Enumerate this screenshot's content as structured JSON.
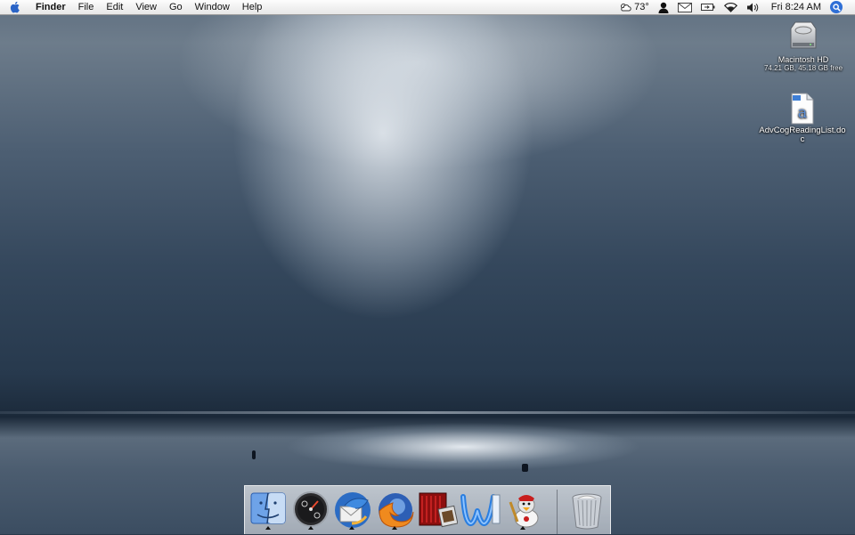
{
  "menubar": {
    "app_name": "Finder",
    "menus": [
      "File",
      "Edit",
      "View",
      "Go",
      "Window",
      "Help"
    ],
    "weather": "73°",
    "clock": "Fri 8:24 AM"
  },
  "desktop": {
    "icons": [
      {
        "label": "Macintosh HD",
        "sub": "74.21 GB, 45.18 GB free"
      },
      {
        "label": "AdvCogReadingList.doc",
        "sub": ""
      }
    ]
  },
  "dock": {
    "items": [
      "finder-icon",
      "dashboard-icon",
      "thunderbird-icon",
      "firefox-icon",
      "imovie-icon",
      "word-icon",
      "adium-duck-icon",
      "trash-icon"
    ]
  },
  "colors": {
    "menubar": "#e6e6e6",
    "accent": "#2f6fd6"
  }
}
